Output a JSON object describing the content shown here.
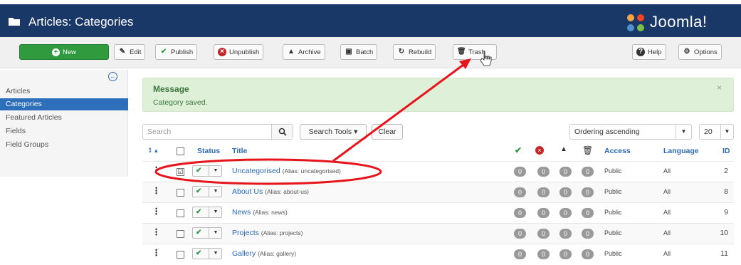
{
  "header": {
    "title": "Articles: Categories",
    "brand": "Joomla!"
  },
  "toolbar": {
    "new": "New",
    "edit": "Edit",
    "publish": "Publish",
    "unpublish": "Unpublish",
    "archive": "Archive",
    "batch": "Batch",
    "rebuild": "Rebuild",
    "trash": "Trash",
    "help": "Help",
    "options": "Options"
  },
  "sidebar": {
    "items": [
      {
        "label": "Articles"
      },
      {
        "label": "Categories"
      },
      {
        "label": "Featured Articles"
      },
      {
        "label": "Fields"
      },
      {
        "label": "Field Groups"
      }
    ]
  },
  "message": {
    "heading": "Message",
    "text": "Category saved.",
    "close": "×"
  },
  "filters": {
    "search_placeholder": "Search",
    "search_tools": "Search Tools ▾",
    "clear": "Clear",
    "ordering": "Ordering ascending",
    "limit": "20"
  },
  "table": {
    "headers": {
      "status": "Status",
      "title": "Title",
      "access": "Access",
      "language": "Language",
      "id": "ID"
    },
    "rows": [
      {
        "title": "Uncategorised",
        "alias": "(Alias: uncategorised)",
        "c1": "0",
        "c2": "0",
        "c3": "0",
        "c4": "0",
        "access": "Public",
        "language": "All",
        "id": "2",
        "checked": "☑"
      },
      {
        "title": "About Us",
        "alias": "(Alias: about-us)",
        "c1": "0",
        "c2": "0",
        "c3": "0",
        "c4": "0",
        "access": "Public",
        "language": "All",
        "id": "8",
        "checked": ""
      },
      {
        "title": "News",
        "alias": "(Alias: news)",
        "c1": "0",
        "c2": "0",
        "c3": "0",
        "c4": "0",
        "access": "Public",
        "language": "All",
        "id": "9",
        "checked": ""
      },
      {
        "title": "Projects",
        "alias": "(Alias: projects)",
        "c1": "0",
        "c2": "0",
        "c3": "0",
        "c4": "0",
        "access": "Public",
        "language": "All",
        "id": "10",
        "checked": ""
      },
      {
        "title": "Gallery",
        "alias": "(Alias: gallery)",
        "c1": "0",
        "c2": "0",
        "c3": "0",
        "c4": "0",
        "access": "Public",
        "language": "All",
        "id": "11",
        "checked": ""
      }
    ]
  },
  "colors": {
    "header": "#1a3867",
    "new_button": "#2f9a3e",
    "active_nav": "#2d6fba",
    "link": "#2a69b8",
    "annotation": "#e8141b"
  },
  "icons": {
    "folder": "folder-icon",
    "brand_logo": "joomla-logo-icon",
    "annotation": "red-ellipse-and-arrow"
  }
}
